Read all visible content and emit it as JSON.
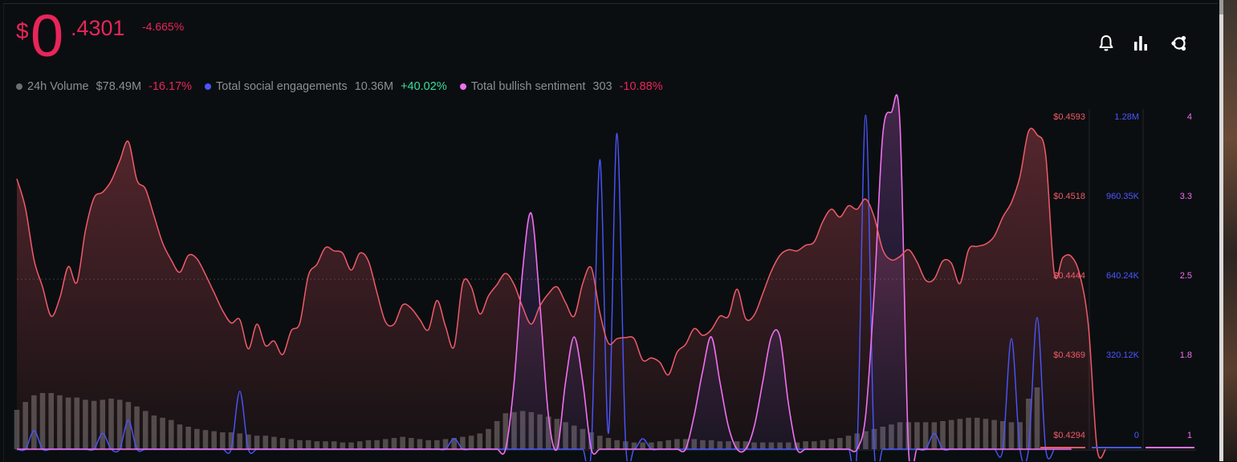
{
  "header": {
    "currency_symbol": "$",
    "price_int": "0",
    "price_dec": ".4301",
    "price_change": "-4.665%"
  },
  "metrics": [
    {
      "dot_color": "#6b6f75",
      "label": "24h Volume",
      "value": "$78.49M",
      "change": "-16.17%",
      "direction": "down"
    },
    {
      "dot_color": "#4a56ff",
      "label": "Total social engagements",
      "value": "10.36M",
      "change": "+40.02%",
      "direction": "up"
    },
    {
      "dot_color": "#f070f0",
      "label": "Total bullish sentiment",
      "value": "303",
      "change": "-10.88%",
      "direction": "down"
    }
  ],
  "toolbar": {
    "icons": [
      "bell-icon",
      "bar-chart-icon",
      "share-icon"
    ]
  },
  "colors": {
    "price": "#f05a6a",
    "engagement": "#4a56ff",
    "bullish": "#f070f0",
    "volume": "#555555",
    "negative": "#e8255a",
    "positive": "#35e0a1"
  },
  "chart_data": {
    "type": "line",
    "x_points": 120,
    "axes": {
      "price": {
        "ticks": [
          "$0.4593",
          "$0.4518",
          "$0.4444",
          "$0.4369",
          "$0.4294"
        ],
        "ylim": [
          0.4294,
          0.4593
        ]
      },
      "engagement": {
        "ticks": [
          "1.28M",
          "960.35K",
          "640.24K",
          "320.12K",
          "0"
        ],
        "ylim": [
          0,
          1280000
        ]
      },
      "bullish": {
        "ticks": [
          "4",
          "3.3",
          "2.5",
          "1.8",
          "1"
        ],
        "ylim": [
          1,
          4
        ]
      }
    },
    "series": [
      {
        "axis": "price",
        "values": [
          0.4534,
          0.4508,
          0.4462,
          0.4438,
          0.4412,
          0.4428,
          0.4456,
          0.4442,
          0.4488,
          0.4517,
          0.4522,
          0.4532,
          0.455,
          0.4567,
          0.4533,
          0.4525,
          0.4501,
          0.4477,
          0.4462,
          0.4451,
          0.4466,
          0.4463,
          0.4449,
          0.4433,
          0.4417,
          0.4406,
          0.4409,
          0.4383,
          0.4405,
          0.4386,
          0.439,
          0.4378,
          0.4399,
          0.4406,
          0.4448,
          0.4458,
          0.4473,
          0.447,
          0.4468,
          0.4453,
          0.4468,
          0.4461,
          0.4433,
          0.4407,
          0.4405,
          0.4422,
          0.4419,
          0.4409,
          0.44,
          0.4426,
          0.4403,
          0.4385,
          0.4441,
          0.4438,
          0.4414,
          0.443,
          0.444,
          0.445,
          0.444,
          0.442,
          0.4405,
          0.4421,
          0.4432,
          0.4438,
          0.4424,
          0.4412,
          0.4441,
          0.4455,
          0.4415,
          0.4388,
          0.4392,
          0.4393,
          0.4392,
          0.4373,
          0.4375,
          0.4371,
          0.436,
          0.438,
          0.4387,
          0.4401,
          0.4395,
          0.44,
          0.4412,
          0.4412,
          0.4436,
          0.441,
          0.4413,
          0.4432,
          0.4452,
          0.4466,
          0.4471,
          0.447,
          0.4475,
          0.4478,
          0.4496,
          0.4507,
          0.45,
          0.451,
          0.4507,
          0.4516,
          0.45,
          0.4471,
          0.4462,
          0.4465,
          0.4471,
          0.446,
          0.4444,
          0.4445,
          0.4461,
          0.4459,
          0.4441,
          0.4471,
          0.4474,
          0.4476,
          0.4483,
          0.45,
          0.4513,
          0.4536,
          0.4576,
          0.4573,
          0.4555,
          0.445,
          0.4464,
          0.4465,
          0.4448,
          0.4402,
          0.4294,
          0.4294
        ]
      },
      {
        "axis": "engagement",
        "values": [
          0,
          0,
          70000,
          0,
          0,
          0,
          0,
          0,
          0,
          0,
          60000,
          0,
          0,
          110000,
          0,
          0,
          0,
          0,
          0,
          0,
          0,
          0,
          0,
          0,
          0,
          0,
          220000,
          0,
          0,
          0,
          0,
          0,
          0,
          0,
          0,
          0,
          0,
          0,
          0,
          0,
          0,
          0,
          0,
          0,
          0,
          0,
          0,
          0,
          0,
          0,
          0,
          40000,
          0,
          0,
          0,
          0,
          0,
          0,
          0,
          0,
          0,
          0,
          0,
          0,
          0,
          0,
          0,
          0,
          1100000,
          60000,
          1200000,
          30000,
          0,
          40000,
          0,
          0,
          0,
          0,
          0,
          0,
          0,
          0,
          0,
          0,
          0,
          0,
          0,
          0,
          0,
          0,
          0,
          0,
          0,
          0,
          0,
          0,
          0,
          0,
          0,
          1270000,
          0,
          0,
          0,
          0,
          0,
          0,
          0,
          60000,
          0,
          0,
          0,
          0,
          0,
          0,
          0,
          0,
          420000,
          0,
          0,
          500000,
          0,
          0
        ]
      },
      {
        "axis": "bullish",
        "values": [
          1,
          1,
          1,
          1,
          1,
          1,
          1,
          1,
          1,
          1,
          1,
          1,
          1,
          1,
          1,
          1,
          1,
          1,
          1,
          1,
          1,
          1,
          1,
          1,
          1,
          1,
          1,
          1,
          1,
          1,
          1,
          1,
          1,
          1,
          1,
          1,
          1,
          1,
          1,
          1,
          1,
          1,
          1,
          1,
          1,
          1,
          1,
          1,
          1,
          1,
          1,
          1,
          1,
          1,
          1,
          1,
          1,
          1,
          1.6,
          2.6,
          3.1,
          2.3,
          1.3,
          1,
          1.6,
          2.0,
          1.6,
          1,
          1,
          1,
          1,
          1,
          1,
          1,
          1,
          1,
          1,
          1,
          1,
          1.3,
          1.7,
          2.0,
          1.6,
          1.2,
          1,
          1,
          1.2,
          1.6,
          2.0,
          2.0,
          1.4,
          1,
          1,
          1,
          1,
          1,
          1,
          1,
          1,
          1.3,
          2.4,
          3.8,
          4.0,
          3.9,
          1,
          1,
          1,
          1,
          1,
          1,
          1,
          1,
          1,
          1,
          1,
          1,
          1,
          1,
          1,
          1,
          1,
          1,
          1,
          1
        ]
      },
      {
        "axis": "volume",
        "values": [
          0.35,
          0.42,
          0.48,
          0.5,
          0.5,
          0.48,
          0.46,
          0.46,
          0.44,
          0.43,
          0.44,
          0.45,
          0.44,
          0.42,
          0.38,
          0.34,
          0.3,
          0.28,
          0.26,
          0.22,
          0.2,
          0.18,
          0.17,
          0.16,
          0.15,
          0.15,
          0.14,
          0.13,
          0.12,
          0.12,
          0.11,
          0.1,
          0.09,
          0.08,
          0.08,
          0.07,
          0.07,
          0.07,
          0.06,
          0.06,
          0.07,
          0.08,
          0.08,
          0.09,
          0.1,
          0.11,
          0.1,
          0.09,
          0.08,
          0.08,
          0.09,
          0.1,
          0.11,
          0.12,
          0.14,
          0.18,
          0.25,
          0.32,
          0.33,
          0.34,
          0.33,
          0.31,
          0.29,
          0.27,
          0.24,
          0.21,
          0.18,
          0.15,
          0.12,
          0.1,
          0.08,
          0.07,
          0.06,
          0.06,
          0.06,
          0.07,
          0.08,
          0.09,
          0.09,
          0.09,
          0.08,
          0.08,
          0.07,
          0.07,
          0.07,
          0.07,
          0.06,
          0.06,
          0.06,
          0.06,
          0.06,
          0.06,
          0.07,
          0.07,
          0.08,
          0.09,
          0.1,
          0.12,
          0.14,
          0.16,
          0.18,
          0.2,
          0.22,
          0.24,
          0.24,
          0.24,
          0.24,
          0.24,
          0.25,
          0.26,
          0.27,
          0.28,
          0.28,
          0.27,
          0.26,
          0.25,
          0.24,
          0.24,
          0.45,
          0.55
        ]
      }
    ],
    "grid": true,
    "legend": "top-left"
  }
}
